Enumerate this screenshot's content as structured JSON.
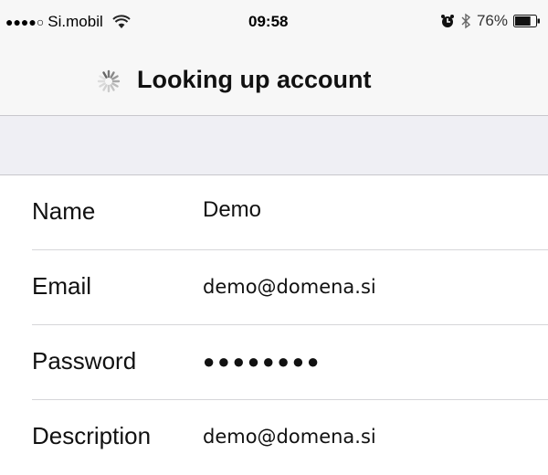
{
  "status_bar": {
    "signal": "●●●●○",
    "carrier": "Si.mobil",
    "time": "09:58",
    "battery_percent": "76%",
    "battery_level": 0.76,
    "icons": [
      "wifi-icon",
      "alarm-icon",
      "bluetooth-icon",
      "battery-icon"
    ]
  },
  "nav": {
    "title": "Looking up account",
    "spinner_icon": "activity-spinner-icon"
  },
  "form": {
    "fields": [
      {
        "label": "Name",
        "value": "Demo"
      },
      {
        "label": "Email",
        "value": "demo@domena.si"
      },
      {
        "label": "Password",
        "value": "●●●●●●●●"
      },
      {
        "label": "Description",
        "value": "demo@domena.si"
      }
    ]
  },
  "colors": {
    "bar_background": "#f7f7f7",
    "group_background": "#efeff4",
    "separator": "#d6d6d9"
  }
}
